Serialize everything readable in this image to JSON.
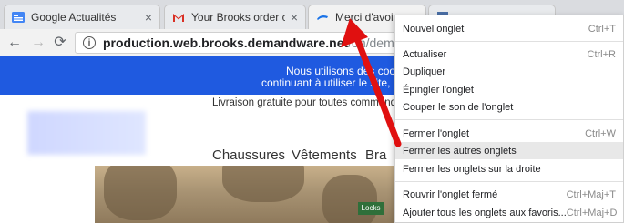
{
  "tabs": [
    {
      "label": "Google Actualités",
      "favicon": "google-news-icon",
      "color": "#4285f4"
    },
    {
      "label": "Your Brooks order confir",
      "favicon": "gmail-icon",
      "color": "#d93025"
    },
    {
      "label": "Merci d'avoir c",
      "favicon": "brooks-logo-icon",
      "color": "#1a73e8"
    },
    {
      "label": "",
      "favicon": "document-icon",
      "color": "#4a6fa5"
    }
  ],
  "toolbar": {
    "back": "←",
    "forward": "→",
    "reload": "⟳",
    "info_glyph": "i",
    "url_host": "production.web.brooks.demandware.net",
    "url_path": "/on/demandwa"
  },
  "page": {
    "cookie_line1": "Nous utilisons des cooki",
    "cookie_line2": "continuant à utiliser le site,",
    "promo": "Livraison gratuite pour toutes commandes",
    "nav": [
      "Chaussures",
      "Vêtements",
      "Bra"
    ],
    "sign": "Locks",
    "banner_color": "#1f5ae0"
  },
  "menu": {
    "items": [
      {
        "label": "Nouvel onglet",
        "shortcut": "Ctrl+T"
      },
      {
        "label": "Actualiser",
        "shortcut": "Ctrl+R"
      },
      {
        "label": "Dupliquer",
        "shortcut": ""
      },
      {
        "label": "Épingler l'onglet",
        "shortcut": ""
      },
      {
        "label": "Couper le son de l'onglet",
        "shortcut": ""
      },
      {
        "label": "Fermer l'onglet",
        "shortcut": "Ctrl+W"
      },
      {
        "label": "Fermer les autres onglets",
        "shortcut": "",
        "highlighted": true
      },
      {
        "label": "Fermer les onglets sur la droite",
        "shortcut": ""
      },
      {
        "label": "Rouvrir l'onglet fermé",
        "shortcut": "Ctrl+Maj+T"
      },
      {
        "label": "Ajouter tous les onglets aux favoris...",
        "shortcut": "Ctrl+Maj+D"
      }
    ]
  },
  "annotation": {
    "color": "#e01010"
  }
}
